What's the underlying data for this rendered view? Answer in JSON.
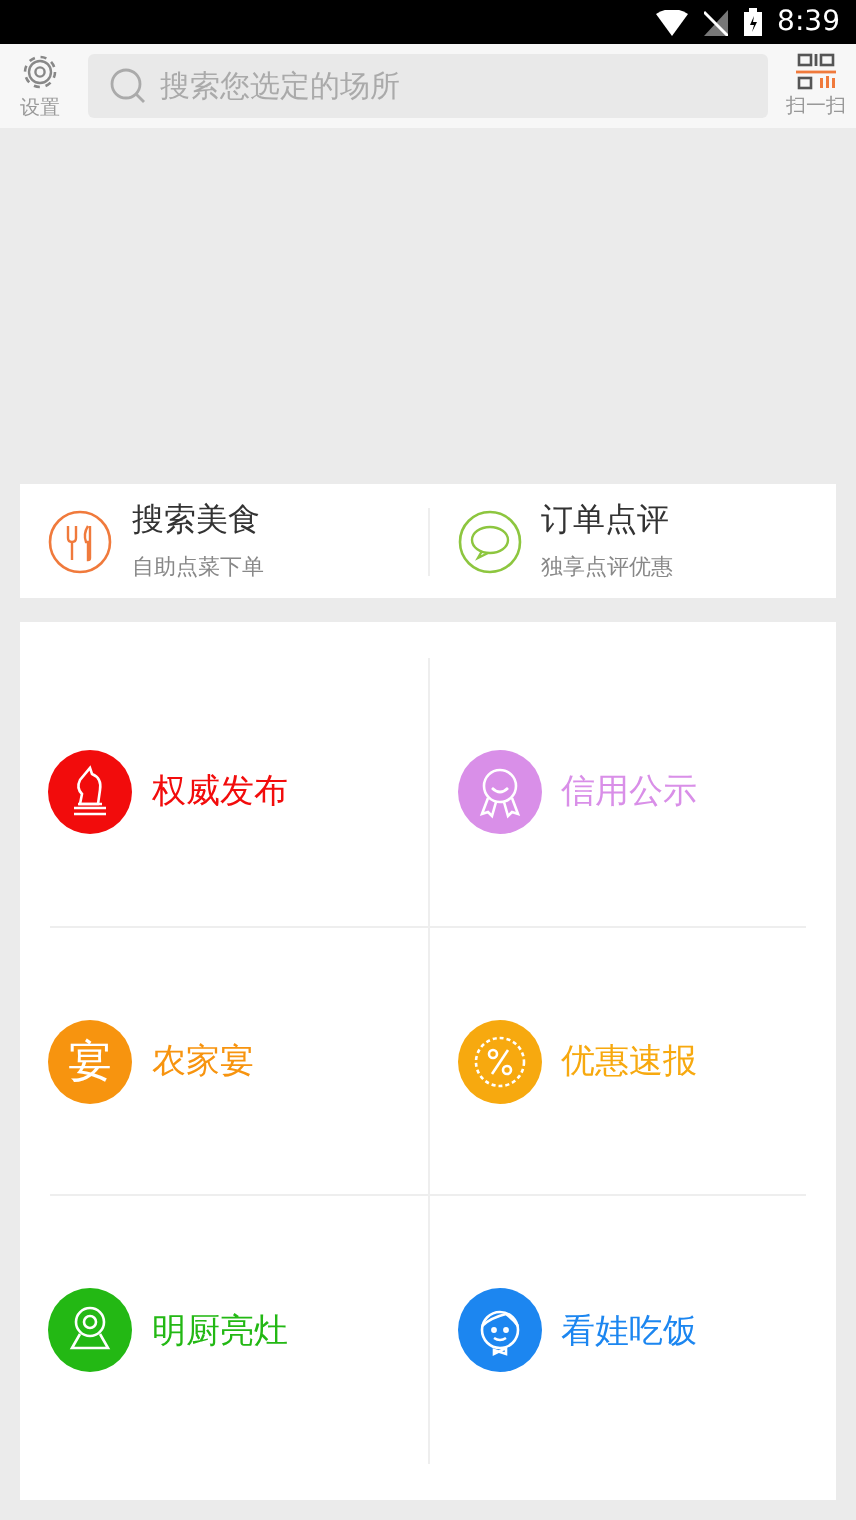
{
  "status_bar": {
    "time": "8:39"
  },
  "top_bar": {
    "settings_label": "设置",
    "search": {
      "placeholder": "搜索您选定的场所"
    },
    "scan_label": "扫一扫"
  },
  "quick_actions": [
    {
      "kind": "food",
      "title": "搜索美食",
      "subtitle": "自助点菜下单",
      "color": "#f07a3c"
    },
    {
      "kind": "review",
      "title": "订单点评",
      "subtitle": "独享点评优惠",
      "color": "#8dc63f"
    }
  ],
  "services": [
    {
      "kind": "knight",
      "label": "权威发布",
      "color": "#f20c0c"
    },
    {
      "kind": "medal",
      "label": "信用公示",
      "color": "#d98fe8"
    },
    {
      "kind": "char",
      "icon_text": "宴",
      "label": "农家宴",
      "color": "#f7940f"
    },
    {
      "kind": "discount",
      "label": "优惠速报",
      "color": "#f7a90f"
    },
    {
      "kind": "camera",
      "label": "明厨亮灶",
      "color": "#23b814"
    },
    {
      "kind": "child",
      "label": "看娃吃饭",
      "color": "#1c86f0"
    }
  ]
}
